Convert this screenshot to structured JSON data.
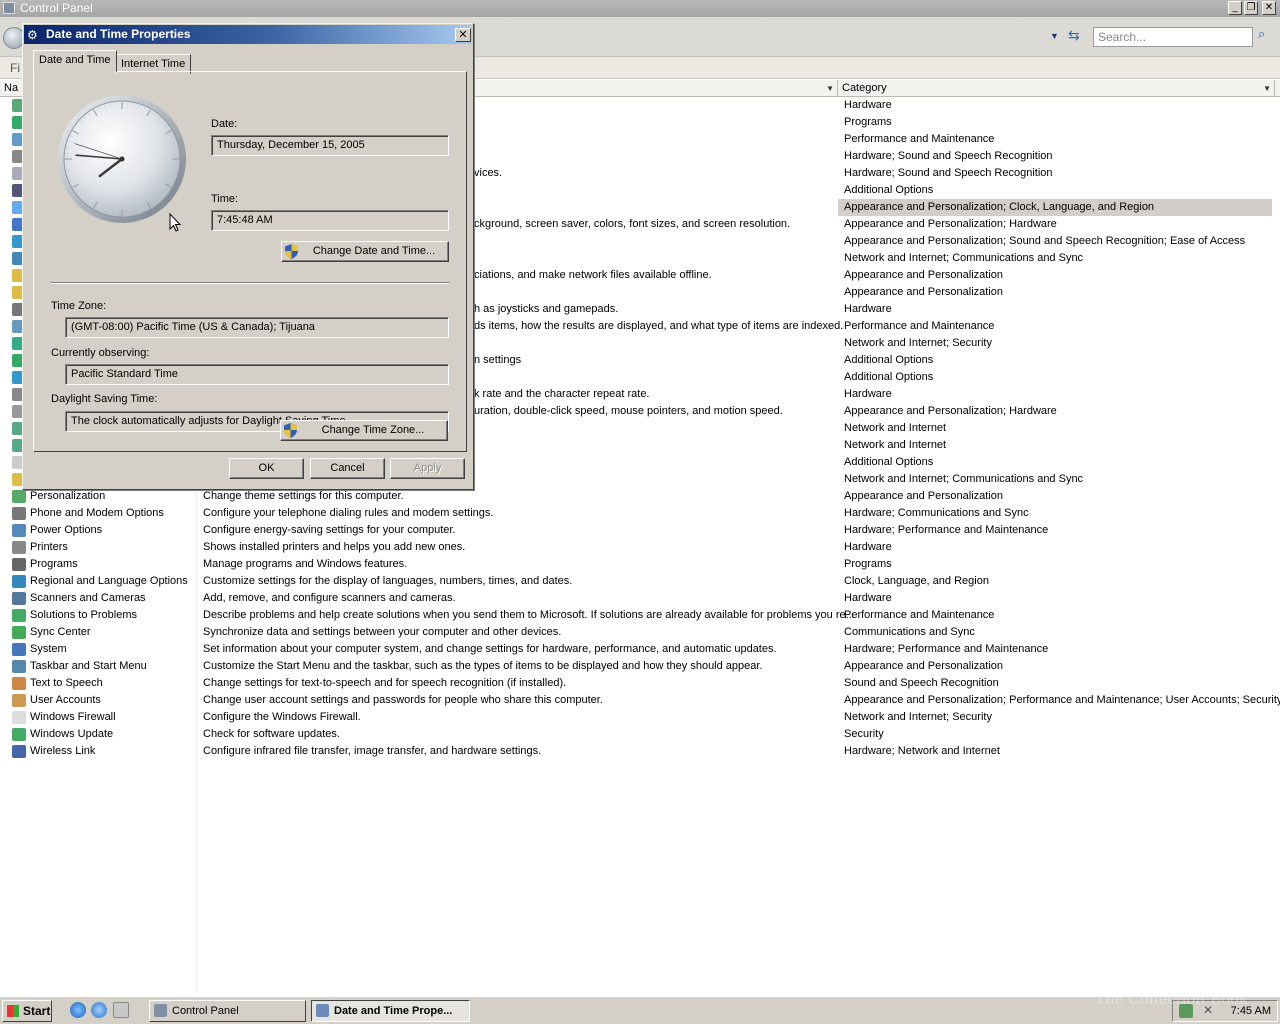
{
  "window": {
    "title": "Control Panel",
    "search_placeholder": "Search...",
    "menu_fragment": "Fi",
    "columns": {
      "name": "Na",
      "category": "Category"
    }
  },
  "rows": [
    {
      "name": "",
      "desc": "",
      "cat": "Hardware",
      "icon": "#5a7"
    },
    {
      "name": "",
      "desc": "",
      "cat": "Programs",
      "icon": "#3a6"
    },
    {
      "name": "",
      "desc": "",
      "cat": "Performance and Maintenance",
      "icon": "#69c"
    },
    {
      "name": "",
      "desc": "",
      "cat": "Hardware; Sound and Speech Recognition",
      "icon": "#888"
    },
    {
      "name": "",
      "desc": "vices.",
      "cat": "Hardware; Sound and Speech Recognition",
      "icon": "#aab"
    },
    {
      "name": "",
      "desc": "",
      "cat": "Additional Options",
      "icon": "#557"
    },
    {
      "name": "",
      "desc": "",
      "cat": "Appearance and Personalization; Clock, Language, and Region",
      "icon": "#6ae",
      "selected": true
    },
    {
      "name": "",
      "desc": "ckground, screen saver, colors, font sizes, and screen resolution.",
      "cat": "Appearance and Personalization; Hardware",
      "icon": "#47c"
    },
    {
      "name": "",
      "desc": "",
      "cat": "Appearance and Personalization; Sound and Speech Recognition; Ease of Access",
      "icon": "#39c"
    },
    {
      "name": "",
      "desc": "",
      "cat": "Network and Internet; Communications and Sync",
      "icon": "#48b"
    },
    {
      "name": "",
      "desc": "ciations, and make network files available offline.",
      "cat": "Appearance and Personalization",
      "icon": "#db4"
    },
    {
      "name": "",
      "desc": "",
      "cat": "Appearance and Personalization",
      "icon": "#db4"
    },
    {
      "name": "",
      "desc": "h as joysticks and gamepads.",
      "cat": "Hardware",
      "icon": "#777"
    },
    {
      "name": "",
      "desc": "ds items, how the results are displayed, and what type of items are indexed.",
      "cat": "Performance and Maintenance",
      "icon": "#69b"
    },
    {
      "name": "",
      "desc": "",
      "cat": "Network and Internet; Security",
      "icon": "#3a8"
    },
    {
      "name": "",
      "desc": "n settings",
      "cat": "Additional Options",
      "icon": "#3a6"
    },
    {
      "name": "",
      "desc": "",
      "cat": "Additional Options",
      "icon": "#39c"
    },
    {
      "name": "",
      "desc": "k rate and the character repeat rate.",
      "cat": "Hardware",
      "icon": "#888"
    },
    {
      "name": "",
      "desc": "uration, double-click speed, mouse pointers, and motion speed.",
      "cat": "Appearance and Personalization; Hardware",
      "icon": "#999"
    },
    {
      "name": "",
      "desc": "",
      "cat": "Network and Internet",
      "icon": "#5a8"
    },
    {
      "name": "",
      "desc": "",
      "cat": "Network and Internet",
      "icon": "#5a8"
    },
    {
      "name": "",
      "desc": "",
      "cat": "Additional Options",
      "icon": "#ccc"
    },
    {
      "name": "",
      "desc": "",
      "cat": "Network and Internet; Communications and Sync",
      "icon": "#db4"
    },
    {
      "name": "Personalization",
      "desc": "Change theme settings for this computer.",
      "cat": "Appearance and Personalization",
      "icon": "#5a6"
    },
    {
      "name": "Phone and Modem Options",
      "desc": "Configure your telephone dialing rules and modem settings.",
      "cat": "Hardware; Communications and Sync",
      "icon": "#777"
    },
    {
      "name": "Power Options",
      "desc": "Configure energy-saving settings for your computer.",
      "cat": "Hardware; Performance and Maintenance",
      "icon": "#58b"
    },
    {
      "name": "Printers",
      "desc": "Shows installed printers and helps you add new ones.",
      "cat": "Hardware",
      "icon": "#888"
    },
    {
      "name": "Programs",
      "desc": "Manage programs and Windows features.",
      "cat": "Programs",
      "icon": "#666"
    },
    {
      "name": "Regional and Language Options",
      "desc": "Customize settings for the display of languages, numbers, times, and dates.",
      "cat": "Clock, Language, and Region",
      "icon": "#38b"
    },
    {
      "name": "Scanners and Cameras",
      "desc": "Add, remove, and configure scanners and cameras.",
      "cat": "Hardware",
      "icon": "#579"
    },
    {
      "name": "Solutions to Problems",
      "desc": "Describe problems and help create solutions when you send them to Microsoft. If solutions are already available for problems you re...",
      "cat": "Performance and Maintenance",
      "icon": "#4a6"
    },
    {
      "name": "Sync Center",
      "desc": "Synchronize data and settings between your computer and other devices.",
      "cat": "Communications and Sync",
      "icon": "#4a5"
    },
    {
      "name": "System",
      "desc": "Set information about your computer system, and change settings for hardware, performance, and automatic updates.",
      "cat": "Hardware; Performance and Maintenance",
      "icon": "#47b"
    },
    {
      "name": "Taskbar and Start Menu",
      "desc": "Customize the Start Menu and the taskbar, such as the types of items to be displayed and how they should appear.",
      "cat": "Appearance and Personalization",
      "icon": "#58a"
    },
    {
      "name": "Text to Speech",
      "desc": "Change settings for text-to-speech and for speech recognition (if installed).",
      "cat": "Sound and Speech Recognition",
      "icon": "#c84"
    },
    {
      "name": "User Accounts",
      "desc": "Change user account settings and passwords for people who share this computer.",
      "cat": "Appearance and Personalization; Performance and Maintenance; User Accounts; Security",
      "icon": "#c95"
    },
    {
      "name": "Windows Firewall",
      "desc": "Configure the Windows Firewall.",
      "cat": "Network and Internet; Security",
      "icon": "#ddd"
    },
    {
      "name": "Windows Update",
      "desc": "Check for software updates.",
      "cat": "Security",
      "icon": "#4a6"
    },
    {
      "name": "Wireless Link",
      "desc": "Configure infrared file transfer, image transfer, and hardware settings.",
      "cat": "Hardware; Network and Internet",
      "icon": "#46a"
    }
  ],
  "dialog": {
    "title": "Date and Time Properties",
    "tabs": {
      "date_time": "Date and Time",
      "internet_time": "Internet Time"
    },
    "date_label": "Date:",
    "date_value": "Thursday, December 15, 2005",
    "time_label": "Time:",
    "time_value": "7:45:48 AM",
    "change_datetime_btn": "Change Date and Time...",
    "timezone_label": "Time Zone:",
    "timezone_value": "(GMT-08:00) Pacific Time (US & Canada); Tijuana",
    "observing_label": "Currently observing:",
    "observing_value": "Pacific Standard Time",
    "dst_label": "Daylight Saving Time:",
    "dst_value": "The clock automatically adjusts for Daylight Saving Time.",
    "change_tz_btn": "Change Time Zone...",
    "ok": "OK",
    "cancel": "Cancel",
    "apply": "Apply",
    "clock": {
      "hour": 7,
      "minute": 45,
      "second": 48
    }
  },
  "taskbar": {
    "start": "Start",
    "items": [
      "Control Panel",
      "Date and Time Prope..."
    ],
    "clock": "7:45 AM",
    "watermark": "The Collection Book"
  }
}
